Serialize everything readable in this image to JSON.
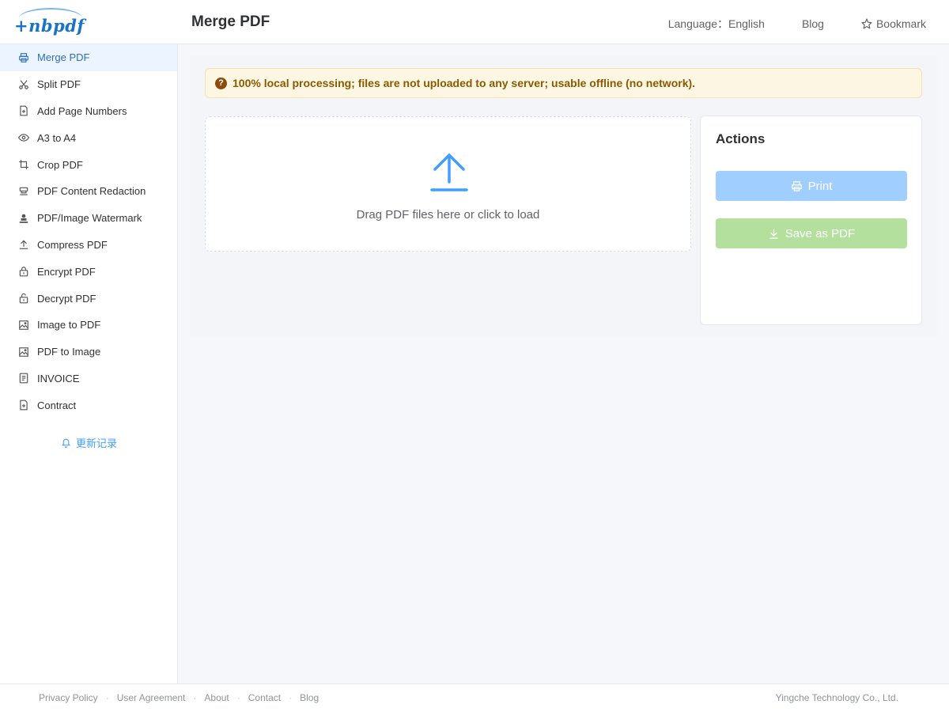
{
  "header": {
    "logo_text": "+nbpdf",
    "title": "Merge PDF",
    "language_label": "Language：English",
    "blog_label": "Blog",
    "bookmark_label": "Bookmark"
  },
  "sidebar": {
    "items": [
      {
        "label": "Merge PDF",
        "icon": "printer-icon",
        "active": true
      },
      {
        "label": "Split PDF",
        "icon": "scissors-icon"
      },
      {
        "label": "Add Page Numbers",
        "icon": "document-add-icon"
      },
      {
        "label": "A3 to A4",
        "icon": "eye-icon"
      },
      {
        "label": "Crop PDF",
        "icon": "crop-icon"
      },
      {
        "label": "PDF Content Redaction",
        "icon": "stamp-icon"
      },
      {
        "label": "PDF/Image Watermark",
        "icon": "watermark-icon"
      },
      {
        "label": "Compress PDF",
        "icon": "upload-icon"
      },
      {
        "label": "Encrypt PDF",
        "icon": "lock-icon"
      },
      {
        "label": "Decrypt PDF",
        "icon": "unlock-icon"
      },
      {
        "label": "Image to PDF",
        "icon": "image-icon"
      },
      {
        "label": "PDF to Image",
        "icon": "image-icon"
      },
      {
        "label": "INVOICE",
        "icon": "tickets-icon"
      },
      {
        "label": "Contract",
        "icon": "document-add-icon"
      }
    ],
    "changelog_label": "更新记录"
  },
  "main": {
    "notice": "100% local processing; files are not uploaded to any server; usable offline (no network).",
    "dropzone_text": "Drag PDF files here or click to load",
    "actions": {
      "title": "Actions",
      "print_label": "Print",
      "save_label": "Save as PDF"
    }
  },
  "footer": {
    "links": [
      "Privacy Policy",
      "User Agreement",
      "About",
      "Contact",
      "Blog"
    ],
    "copyright": "Yingche Technology Co., Ltd."
  },
  "colors": {
    "accent": "#409eff",
    "active_bg": "#ecf5ff",
    "print_button": "#a0cfff",
    "save_button": "#b3e19d",
    "notice_bg": "#fdf6e3",
    "notice_text": "#8a5a00"
  }
}
